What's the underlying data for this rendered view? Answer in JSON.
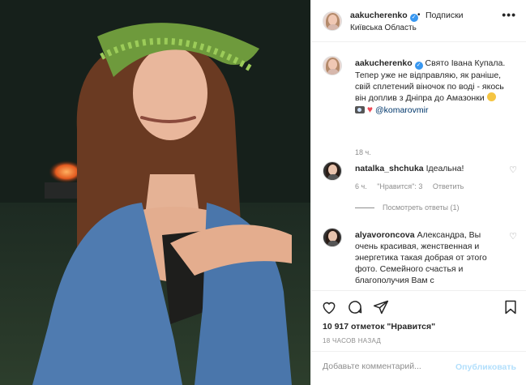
{
  "post": {
    "username": "aakucherenko",
    "follow_label": "Подписки",
    "location": "Київська Область",
    "more_label": "•••"
  },
  "caption": {
    "username": "aakucherenko",
    "text": "Свято Івана Купала. Тепер уже не відправляю, як раніше, свій сплетений віночок по воді - якось він доплив з Дніпра до Амазонки",
    "mention": "@komarovmir",
    "time": "18 ч."
  },
  "comments": [
    {
      "username": "natalka_shchuka",
      "text": "Ідеальна!",
      "time": "6 ч.",
      "likes_label": "\"Нравится\": 3",
      "reply_label": "Ответить",
      "view_replies": "Посмотреть ответы (1)"
    },
    {
      "username": "alyavoroncova",
      "text": "Александра, Вы очень красивая, женственная и энергетика такая добрая от этого фото. Семейного счастья и благополучия Вам с"
    }
  ],
  "actions": {
    "likes": "10 917 отметок \"Нравится\"",
    "ago": "18 ЧАСОВ НАЗАД"
  },
  "add_comment": {
    "placeholder": "Добавьте комментарий...",
    "post_label": "Опубликовать"
  },
  "colors": {
    "verified": "#3897f0",
    "mention": "#00376b",
    "post_disabled": "#b2dffc",
    "heart": "#ed4956"
  }
}
